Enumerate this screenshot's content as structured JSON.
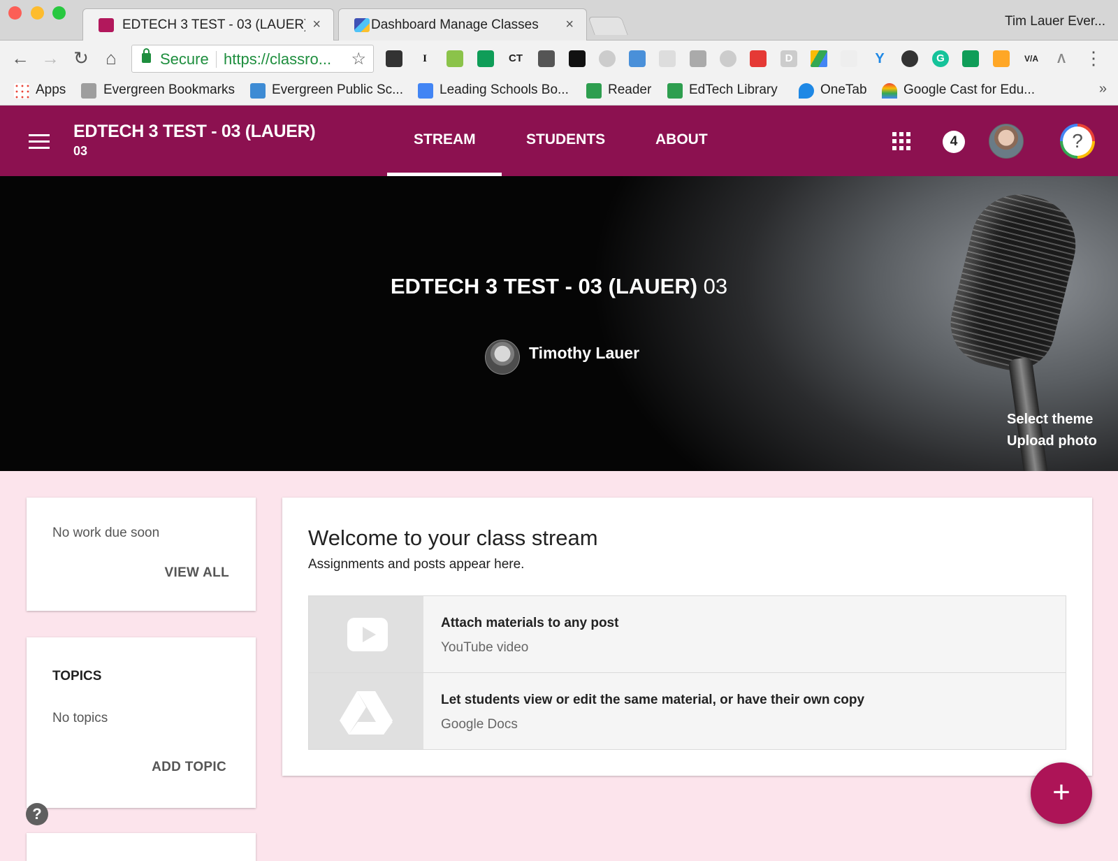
{
  "browser": {
    "tabs": [
      {
        "title": "EDTECH 3 TEST - 03 (LAUER)",
        "active": true
      },
      {
        "title": "Dashboard Manage Classes",
        "active": false
      }
    ],
    "tab_close_glyph": "×",
    "profile_name": "Tim Lauer Ever...",
    "address": {
      "secure_label": "Secure",
      "url": "https://classro..."
    },
    "bookmarks": [
      {
        "label": "Apps",
        "icon": "apps-grid-icon"
      },
      {
        "label": "Evergreen Bookmarks",
        "icon": "folder-icon"
      },
      {
        "label": "Evergreen Public Sc...",
        "icon": "weebly-icon"
      },
      {
        "label": "Leading Schools Bo...",
        "icon": "doc-icon"
      },
      {
        "label": "Reader",
        "icon": "eps-icon"
      },
      {
        "label": "EdTech Library",
        "icon": "eps-icon"
      },
      {
        "label": "OneTab",
        "icon": "onetab-icon"
      },
      {
        "label": "Google Cast for Edu...",
        "icon": "cast-icon"
      }
    ],
    "extension_text": {
      "ct": "CT",
      "i": "I",
      "d": "D",
      "g": "G",
      "va": "V/A"
    }
  },
  "class_header": {
    "title": "EDTECH 3 TEST - 03 (LAUER)",
    "section": "03",
    "nav": [
      "STREAM",
      "STUDENTS",
      "ABOUT"
    ],
    "active_tab": "STREAM",
    "notification_count": "4",
    "help_glyph": "?"
  },
  "banner": {
    "title": "EDTECH 3 TEST - 03 (LAUER)",
    "section": "03",
    "teacher": "Timothy Lauer",
    "select_theme": "Select theme",
    "upload_photo": "Upload photo"
  },
  "upcoming": {
    "text": "No work due soon",
    "view_all": "VIEW ALL"
  },
  "topics": {
    "header": "TOPICS",
    "empty": "No topics",
    "add": "ADD TOPIC"
  },
  "stream": {
    "heading": "Welcome to your class stream",
    "subheading": "Assignments and posts appear here.",
    "tips": [
      {
        "title": "Attach materials to any post",
        "subtitle": "YouTube video",
        "icon": "youtube-icon"
      },
      {
        "title": "Let students view or edit the same material, or have their own copy",
        "subtitle": "Google Docs",
        "icon": "google-drive-icon"
      }
    ]
  },
  "fab_glyph": "+",
  "help_float_glyph": "?",
  "colors": {
    "header": "#8c1150",
    "page_bg": "#fce4ec",
    "fab": "#ad1457",
    "secure_green": "#1e8e3e"
  }
}
